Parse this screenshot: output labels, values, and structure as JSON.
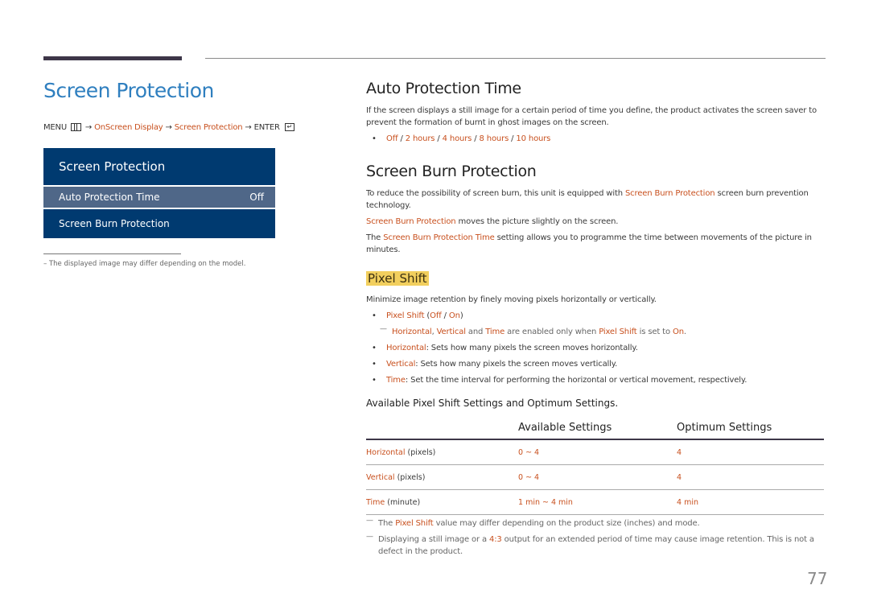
{
  "left": {
    "title": "Screen Protection",
    "menu_path": {
      "menu": "MENU",
      "arrow": "→",
      "step1": "OnScreen Display",
      "step2": "Screen Protection",
      "enter": "ENTER",
      "enter_glyph": "↵"
    },
    "osd": {
      "header": "Screen Protection",
      "items": [
        {
          "label": "Auto Protection Time",
          "value": "Off",
          "selected": true
        },
        {
          "label": "Screen Burn Protection",
          "value": "",
          "selected": false
        }
      ]
    },
    "note": "–  The displayed image may differ depending on the model."
  },
  "auto_protection": {
    "title": "Auto Protection Time",
    "description": "If the screen displays a still image for a certain period of time you define, the product activates the screen saver to prevent the formation of burnt in ghost images on the screen.",
    "options": [
      "Off",
      "2 hours",
      "4 hours",
      "8 hours",
      "10 hours"
    ],
    "sep": " / "
  },
  "screen_burn": {
    "title": "Screen Burn Protection",
    "p1_before": "To reduce the possibility of screen burn, this unit is equipped with ",
    "p1_hl": "Screen Burn Protection",
    "p1_after": " screen burn prevention technology.",
    "p2_hl": "Screen Burn Protection",
    "p2_after": " moves the picture slightly on the screen.",
    "p3_before": "The ",
    "p3_hl": "Screen Burn Protection Time",
    "p3_after": " setting allows you to programme the time between movements of the picture in minutes."
  },
  "pixel_shift": {
    "title": "Pixel Shift",
    "description": "Minimize image retention by finely moving pixels horizontally or vertically.",
    "bullet_label": "Pixel Shift",
    "bullet_off": "Off",
    "bullet_on": "On",
    "note": {
      "horizontal": "Horizontal",
      "vertical": "Vertical",
      "and": " and ",
      "time": "Time",
      "middle": " are enabled only when ",
      "pixel_shift": "Pixel Shift",
      "set_to": " is set to ",
      "on": "On"
    },
    "bullets": [
      {
        "label": "Horizontal",
        "text": ": Sets how many pixels the screen moves horizontally."
      },
      {
        "label": "Vertical",
        "text": ": Sets how many pixels the screen moves vertically."
      },
      {
        "label": "Time",
        "text": ": Set the time interval for performing the horizontal or vertical movement, respectively."
      }
    ],
    "table_caption": "Available Pixel Shift Settings and Optimum Settings.",
    "table": {
      "headers": [
        "",
        "Available Settings",
        "Optimum Settings"
      ],
      "rows": [
        {
          "label": "Horizontal",
          "unit": " (pixels)",
          "available": "0 ~ 4",
          "optimum": "4"
        },
        {
          "label": "Vertical",
          "unit": " (pixels)",
          "available": "0 ~ 4",
          "optimum": "4"
        },
        {
          "label": "Time",
          "unit": " (minute)",
          "available": "1 min ~ 4 min",
          "optimum": "4 min"
        }
      ]
    },
    "footnotes": {
      "f1_before": "The ",
      "f1_hl": "Pixel Shift",
      "f1_after": " value may differ depending on the product size (inches) and mode.",
      "f2_before": "Displaying a still image or a ",
      "f2_hl": "4:3",
      "f2_after": " output for an extended period of time may cause image retention. This is not a defect in the product."
    }
  },
  "page_number": "77",
  "colors": {
    "accent_blue": "#2f7fbf",
    "highlight": "#c8501e",
    "osd_bg": "#003a70",
    "osd_selected": "#4f6788",
    "title_marker": "#f2cf5e"
  }
}
